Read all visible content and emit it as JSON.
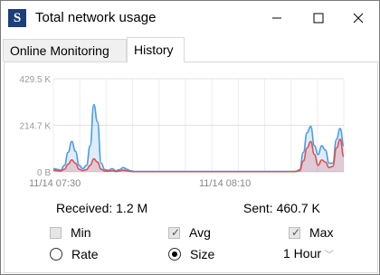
{
  "window": {
    "title": "Total network usage",
    "app_icon_letter": "S",
    "accent": "#1c3f7a"
  },
  "tabs": [
    {
      "label": "Online Monitoring",
      "active": false
    },
    {
      "label": "History",
      "active": true
    }
  ],
  "chart_data": {
    "type": "area",
    "y_tick_labels": [
      "429.5 K",
      "214.7 K",
      "0 B"
    ],
    "x_tick_labels": [
      "11/14 07:30",
      "11/14 08:10"
    ],
    "ylim": [
      0,
      429.5
    ],
    "grid": true,
    "series": [
      {
        "name": "Max",
        "color": "#4a9be8",
        "x": [
          0,
          1,
          2,
          3,
          4,
          5,
          6,
          7,
          8,
          9,
          10,
          11,
          12,
          13,
          14,
          15,
          16,
          17,
          18,
          19,
          20,
          21,
          22,
          23,
          24,
          25,
          26,
          27,
          28,
          29,
          30,
          31,
          32,
          33,
          34,
          35,
          36,
          37,
          38,
          39,
          40,
          41,
          42,
          43,
          44,
          45,
          46,
          47,
          48,
          49,
          50,
          51,
          52,
          53,
          54,
          55,
          56,
          57,
          58,
          59,
          60,
          61,
          62,
          63,
          64,
          65,
          66,
          67,
          68,
          69,
          70,
          71,
          72,
          73,
          74,
          75,
          76,
          77,
          78,
          79
        ],
        "values": [
          15,
          12,
          8,
          30,
          90,
          140,
          95,
          30,
          15,
          30,
          120,
          310,
          230,
          40,
          10,
          8,
          15,
          5,
          10,
          20,
          12,
          5,
          2,
          2,
          2,
          2,
          2,
          2,
          2,
          2,
          2,
          2,
          2,
          2,
          2,
          2,
          2,
          2,
          2,
          2,
          2,
          2,
          2,
          2,
          2,
          2,
          2,
          2,
          2,
          2,
          2,
          2,
          2,
          2,
          2,
          2,
          2,
          2,
          2,
          2,
          2,
          2,
          2,
          2,
          2,
          2,
          3,
          10,
          90,
          180,
          210,
          120,
          80,
          120,
          100,
          40,
          40,
          150,
          200,
          120
        ]
      },
      {
        "name": "Avg",
        "color": "#e05050",
        "x": [
          0,
          1,
          2,
          3,
          4,
          5,
          6,
          7,
          8,
          9,
          10,
          11,
          12,
          13,
          14,
          15,
          16,
          17,
          18,
          19,
          20,
          21,
          22,
          23,
          24,
          25,
          26,
          27,
          28,
          29,
          30,
          31,
          32,
          33,
          34,
          35,
          36,
          37,
          38,
          39,
          40,
          41,
          42,
          43,
          44,
          45,
          46,
          47,
          48,
          49,
          50,
          51,
          52,
          53,
          54,
          55,
          56,
          57,
          58,
          59,
          60,
          61,
          62,
          63,
          64,
          65,
          66,
          67,
          68,
          69,
          70,
          71,
          72,
          73,
          74,
          75,
          76,
          77,
          78,
          79
        ],
        "values": [
          8,
          6,
          4,
          12,
          35,
          55,
          40,
          12,
          6,
          10,
          30,
          60,
          45,
          12,
          4,
          3,
          6,
          2,
          4,
          8,
          5,
          2,
          1,
          1,
          1,
          1,
          1,
          1,
          1,
          1,
          1,
          1,
          1,
          1,
          1,
          1,
          1,
          1,
          1,
          1,
          1,
          1,
          1,
          1,
          1,
          1,
          1,
          1,
          1,
          1,
          1,
          1,
          1,
          1,
          1,
          1,
          1,
          1,
          1,
          1,
          1,
          1,
          1,
          1,
          1,
          1,
          2,
          6,
          50,
          110,
          140,
          80,
          30,
          55,
          45,
          20,
          25,
          110,
          150,
          70
        ]
      }
    ]
  },
  "stats": {
    "received": "Received: 1.2 M",
    "sent": "Sent: 460.7 K"
  },
  "options": {
    "min_label": "Min",
    "min_checked": false,
    "avg_label": "Avg",
    "avg_checked": true,
    "max_label": "Max",
    "max_checked": true,
    "rate_label": "Rate",
    "rate_selected": false,
    "size_label": "Size",
    "size_selected": true,
    "interval_value": "1 Hour",
    "check_glyph": "✓"
  }
}
